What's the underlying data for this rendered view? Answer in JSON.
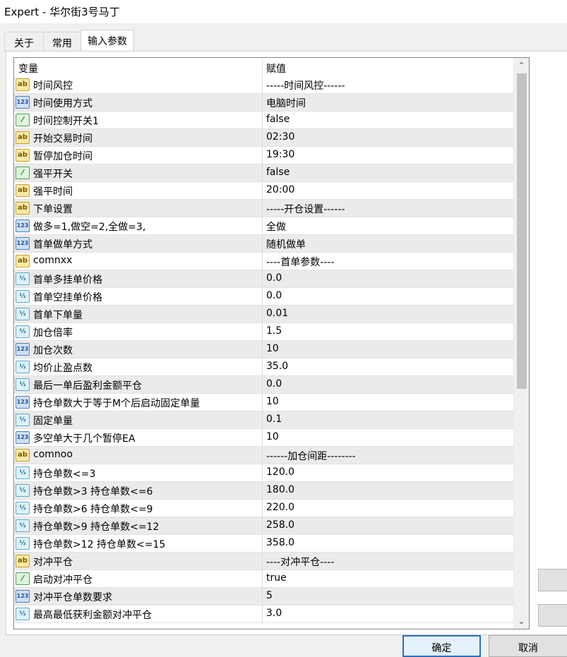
{
  "window": {
    "title": "Expert - 华尔街3号马丁"
  },
  "tabs": [
    {
      "label": "关于"
    },
    {
      "label": "常用"
    },
    {
      "label": "输入参数"
    }
  ],
  "grid": {
    "header": {
      "variable": "变量",
      "value": "赋值"
    },
    "rows": [
      {
        "icon": "string-icon",
        "name": "时间风控",
        "value": "-----时间风控------"
      },
      {
        "icon": "integer-icon",
        "name": "时间使用方式",
        "value": "电脑时间"
      },
      {
        "icon": "boolean-icon",
        "name": "时间控制开关1",
        "value": "false"
      },
      {
        "icon": "string-icon",
        "name": "开始交易时间",
        "value": "02:30"
      },
      {
        "icon": "string-icon",
        "name": "暂停加仓时间",
        "value": "19:30"
      },
      {
        "icon": "boolean-icon",
        "name": "强平开关",
        "value": "false"
      },
      {
        "icon": "string-icon",
        "name": "强平时间",
        "value": "20:00"
      },
      {
        "icon": "string-icon",
        "name": "下单设置",
        "value": "-----开仓设置------"
      },
      {
        "icon": "integer-icon",
        "name": "做多=1,做空=2,全做=3,",
        "value": "全做"
      },
      {
        "icon": "integer-icon",
        "name": "首单做单方式",
        "value": "随机做单"
      },
      {
        "icon": "string-icon",
        "name": "comnxx",
        "value": "----首单参数----"
      },
      {
        "icon": "double-icon",
        "name": "首单多挂单价格",
        "value": "0.0"
      },
      {
        "icon": "double-icon",
        "name": "首单空挂单价格",
        "value": "0.0"
      },
      {
        "icon": "double-icon",
        "name": "首单下单量",
        "value": "0.01"
      },
      {
        "icon": "double-icon",
        "name": "加仓倍率",
        "value": "1.5"
      },
      {
        "icon": "integer-icon",
        "name": "加仓次数",
        "value": "10"
      },
      {
        "icon": "double-icon",
        "name": "均价止盈点数",
        "value": "35.0"
      },
      {
        "icon": "double-icon",
        "name": "最后一单后盈利金额平仓",
        "value": "0.0"
      },
      {
        "icon": "integer-icon",
        "name": "持仓单数大于等于M个后启动固定单量",
        "value": "10"
      },
      {
        "icon": "double-icon",
        "name": "固定单量",
        "value": "0.1"
      },
      {
        "icon": "integer-icon",
        "name": "多空单大于几个暂停EA",
        "value": "10"
      },
      {
        "icon": "string-icon",
        "name": "comnoo",
        "value": "------加仓间距--------"
      },
      {
        "icon": "double-icon",
        "name": "持仓单数<=3",
        "value": "120.0"
      },
      {
        "icon": "double-icon",
        "name": "持仓单数>3   持仓单数<=6",
        "value": "180.0"
      },
      {
        "icon": "double-icon",
        "name": "持仓单数>6   持仓单数<=9",
        "value": "220.0"
      },
      {
        "icon": "double-icon",
        "name": "持仓单数>9   持仓单数<=12",
        "value": "258.0"
      },
      {
        "icon": "double-icon",
        "name": "持仓单数>12  持仓单数<=15",
        "value": "358.0"
      },
      {
        "icon": "string-icon",
        "name": "对冲平仓",
        "value": "----对冲平仓----"
      },
      {
        "icon": "boolean-icon",
        "name": "启动对冲平仓",
        "value": "true"
      },
      {
        "icon": "integer-icon",
        "name": "对冲平仓单数要求",
        "value": "5"
      },
      {
        "icon": "double-icon",
        "name": "最高最低获利金额对冲平仓",
        "value": "3.0"
      }
    ]
  },
  "icon_glyphs": {
    "string-icon": "ab",
    "integer-icon": "123",
    "double-icon": "½",
    "boolean-icon": "⁄"
  },
  "buttons": {
    "ok": "确定",
    "cancel": "取消"
  },
  "colors": {
    "primary_border": "#2e6fc1",
    "scroll_thumb": "#c2c2c2"
  }
}
